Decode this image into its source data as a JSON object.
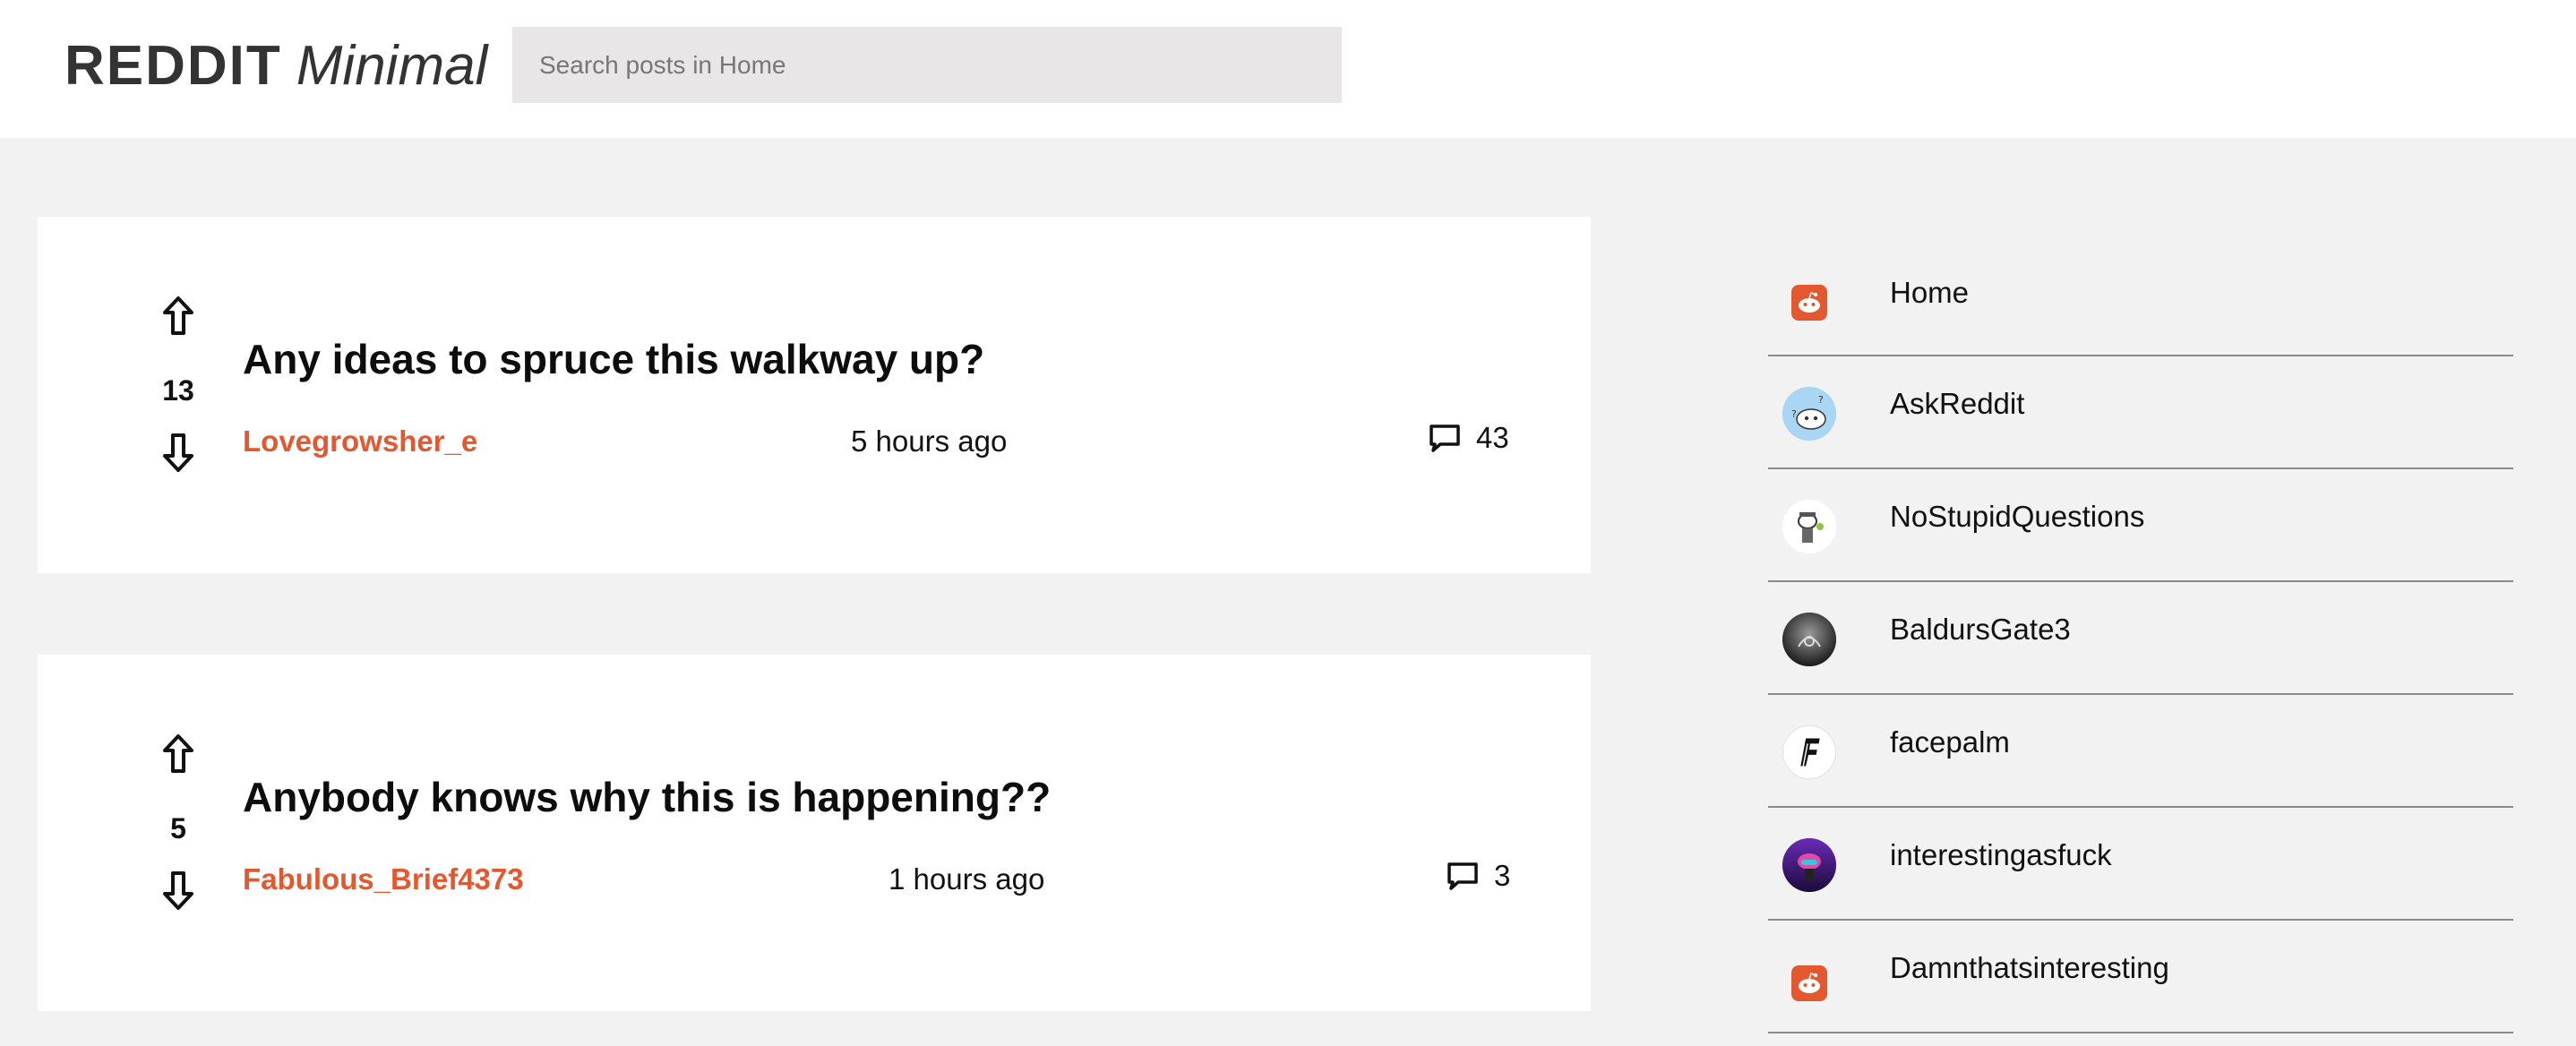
{
  "header": {
    "logo_bold": "REDDIT",
    "logo_light": "Minimal",
    "search_placeholder": "Search posts in Home"
  },
  "posts": [
    {
      "score": "13",
      "title": "Any ideas to spruce this walkway up?",
      "author": "Lovegrowsher_e",
      "time": "5 hours ago",
      "comments": "43"
    },
    {
      "score": "5",
      "title": "Anybody knows why this is happening??",
      "author": "Fabulous_Brief4373",
      "time": "1 hours ago",
      "comments": "3"
    }
  ],
  "sidebar": {
    "items": [
      {
        "label": "Home",
        "icon": "reddit-logo-icon"
      },
      {
        "label": "AskReddit",
        "icon": "askreddit-avatar-icon"
      },
      {
        "label": "NoStupidQuestions",
        "icon": "nostupidquestions-avatar-icon"
      },
      {
        "label": "BaldursGate3",
        "icon": "baldursgate3-avatar-icon"
      },
      {
        "label": "facepalm",
        "icon": "facepalm-avatar-icon"
      },
      {
        "label": "interestingasfuck",
        "icon": "interestingasfuck-avatar-icon"
      },
      {
        "label": "Damnthatsinteresting",
        "icon": "reddit-logo-icon"
      }
    ]
  },
  "colors": {
    "accent": "#e4582f",
    "background": "#f2f2f2",
    "card": "#ffffff",
    "search_bg": "#e8e6e7"
  }
}
